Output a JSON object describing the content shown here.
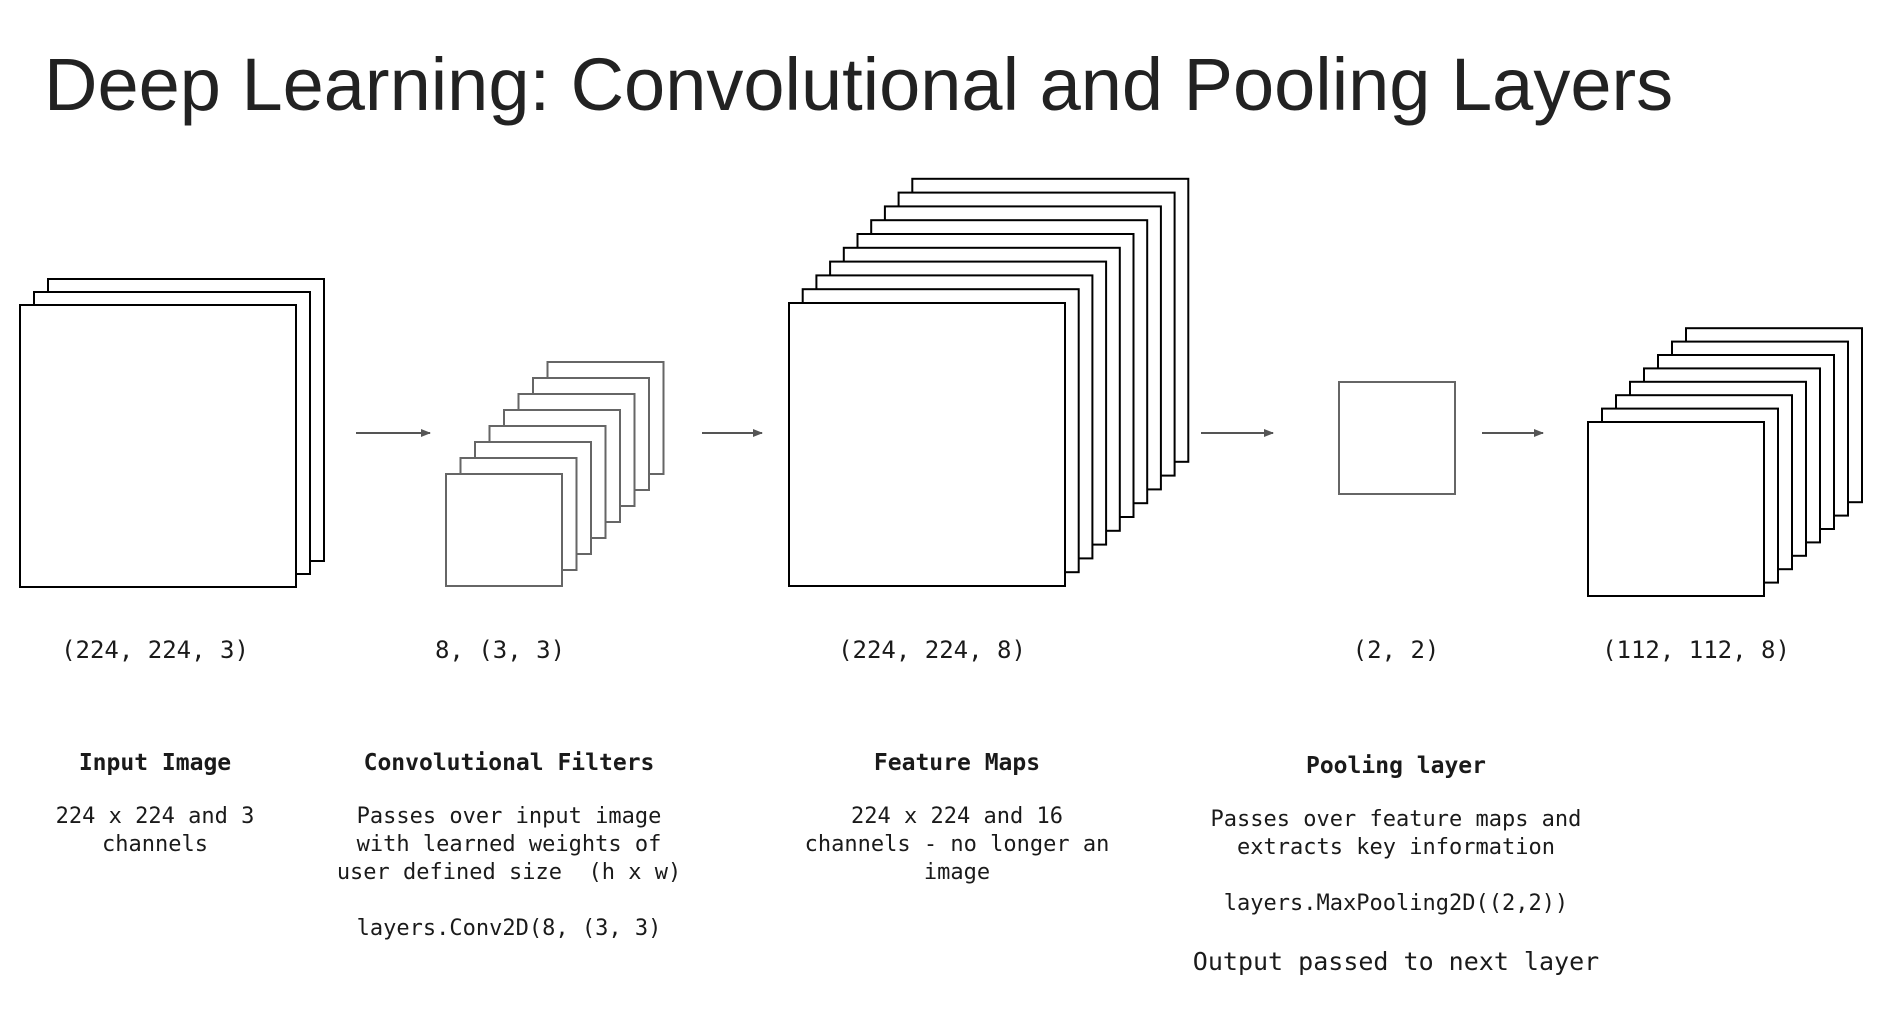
{
  "title": "Deep Learning: Convolutional and Pooling Layers",
  "colors": {
    "stack_stroke": "#000000",
    "filter_stroke": "#666666",
    "arrow": "#555555",
    "title": "#222222"
  },
  "stages": [
    {
      "id": "input",
      "dims": "(224, 224, 3)"
    },
    {
      "id": "filters",
      "dims": "8, (3, 3)"
    },
    {
      "id": "feature_maps",
      "dims": "(224, 224, 8)"
    },
    {
      "id": "pool_window",
      "dims": "(2, 2)"
    },
    {
      "id": "pooled_output",
      "dims": "(112, 112, 8)"
    }
  ],
  "descriptions": {
    "input": {
      "title": "Input Image",
      "lines": [
        "224 x 224 and 3",
        "channels"
      ]
    },
    "conv": {
      "title": "Convolutional Filters",
      "lines": [
        "Passes over input image",
        "with learned weights of",
        "user defined size  (h x w)"
      ],
      "code": "layers.Conv2D(8, (3, 3)"
    },
    "features": {
      "title": "Feature Maps",
      "lines": [
        "224 x 224 and 16",
        "channels - no longer an",
        "image"
      ]
    },
    "pooling": {
      "title": "Pooling layer",
      "lines": [
        "Passes over feature maps and",
        "extracts key information"
      ],
      "code": "layers.MaxPooling2D((2,2))",
      "note": "Output passed to next layer"
    }
  }
}
